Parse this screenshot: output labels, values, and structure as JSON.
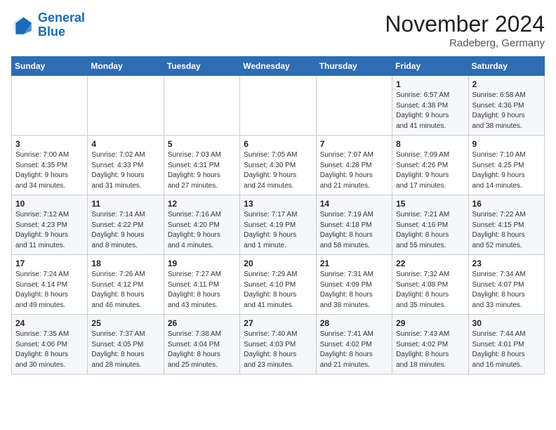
{
  "logo": {
    "text_general": "General",
    "text_blue": "Blue"
  },
  "header": {
    "month": "November 2024",
    "location": "Radeberg, Germany"
  },
  "weekdays": [
    "Sunday",
    "Monday",
    "Tuesday",
    "Wednesday",
    "Thursday",
    "Friday",
    "Saturday"
  ],
  "weeks": [
    [
      {
        "day": "",
        "info": ""
      },
      {
        "day": "",
        "info": ""
      },
      {
        "day": "",
        "info": ""
      },
      {
        "day": "",
        "info": ""
      },
      {
        "day": "",
        "info": ""
      },
      {
        "day": "1",
        "info": "Sunrise: 6:57 AM\nSunset: 4:38 PM\nDaylight: 9 hours\nand 41 minutes."
      },
      {
        "day": "2",
        "info": "Sunrise: 6:58 AM\nSunset: 4:36 PM\nDaylight: 9 hours\nand 38 minutes."
      }
    ],
    [
      {
        "day": "3",
        "info": "Sunrise: 7:00 AM\nSunset: 4:35 PM\nDaylight: 9 hours\nand 34 minutes."
      },
      {
        "day": "4",
        "info": "Sunrise: 7:02 AM\nSunset: 4:33 PM\nDaylight: 9 hours\nand 31 minutes."
      },
      {
        "day": "5",
        "info": "Sunrise: 7:03 AM\nSunset: 4:31 PM\nDaylight: 9 hours\nand 27 minutes."
      },
      {
        "day": "6",
        "info": "Sunrise: 7:05 AM\nSunset: 4:30 PM\nDaylight: 9 hours\nand 24 minutes."
      },
      {
        "day": "7",
        "info": "Sunrise: 7:07 AM\nSunset: 4:28 PM\nDaylight: 9 hours\nand 21 minutes."
      },
      {
        "day": "8",
        "info": "Sunrise: 7:09 AM\nSunset: 4:26 PM\nDaylight: 9 hours\nand 17 minutes."
      },
      {
        "day": "9",
        "info": "Sunrise: 7:10 AM\nSunset: 4:25 PM\nDaylight: 9 hours\nand 14 minutes."
      }
    ],
    [
      {
        "day": "10",
        "info": "Sunrise: 7:12 AM\nSunset: 4:23 PM\nDaylight: 9 hours\nand 11 minutes."
      },
      {
        "day": "11",
        "info": "Sunrise: 7:14 AM\nSunset: 4:22 PM\nDaylight: 9 hours\nand 8 minutes."
      },
      {
        "day": "12",
        "info": "Sunrise: 7:16 AM\nSunset: 4:20 PM\nDaylight: 9 hours\nand 4 minutes."
      },
      {
        "day": "13",
        "info": "Sunrise: 7:17 AM\nSunset: 4:19 PM\nDaylight: 9 hours\nand 1 minute."
      },
      {
        "day": "14",
        "info": "Sunrise: 7:19 AM\nSunset: 4:18 PM\nDaylight: 8 hours\nand 58 minutes."
      },
      {
        "day": "15",
        "info": "Sunrise: 7:21 AM\nSunset: 4:16 PM\nDaylight: 8 hours\nand 55 minutes."
      },
      {
        "day": "16",
        "info": "Sunrise: 7:22 AM\nSunset: 4:15 PM\nDaylight: 8 hours\nand 52 minutes."
      }
    ],
    [
      {
        "day": "17",
        "info": "Sunrise: 7:24 AM\nSunset: 4:14 PM\nDaylight: 8 hours\nand 49 minutes."
      },
      {
        "day": "18",
        "info": "Sunrise: 7:26 AM\nSunset: 4:12 PM\nDaylight: 8 hours\nand 46 minutes."
      },
      {
        "day": "19",
        "info": "Sunrise: 7:27 AM\nSunset: 4:11 PM\nDaylight: 8 hours\nand 43 minutes."
      },
      {
        "day": "20",
        "info": "Sunrise: 7:29 AM\nSunset: 4:10 PM\nDaylight: 8 hours\nand 41 minutes."
      },
      {
        "day": "21",
        "info": "Sunrise: 7:31 AM\nSunset: 4:09 PM\nDaylight: 8 hours\nand 38 minutes."
      },
      {
        "day": "22",
        "info": "Sunrise: 7:32 AM\nSunset: 4:08 PM\nDaylight: 8 hours\nand 35 minutes."
      },
      {
        "day": "23",
        "info": "Sunrise: 7:34 AM\nSunset: 4:07 PM\nDaylight: 8 hours\nand 33 minutes."
      }
    ],
    [
      {
        "day": "24",
        "info": "Sunrise: 7:35 AM\nSunset: 4:06 PM\nDaylight: 8 hours\nand 30 minutes."
      },
      {
        "day": "25",
        "info": "Sunrise: 7:37 AM\nSunset: 4:05 PM\nDaylight: 8 hours\nand 28 minutes."
      },
      {
        "day": "26",
        "info": "Sunrise: 7:38 AM\nSunset: 4:04 PM\nDaylight: 8 hours\nand 25 minutes."
      },
      {
        "day": "27",
        "info": "Sunrise: 7:40 AM\nSunset: 4:03 PM\nDaylight: 8 hours\nand 23 minutes."
      },
      {
        "day": "28",
        "info": "Sunrise: 7:41 AM\nSunset: 4:02 PM\nDaylight: 8 hours\nand 21 minutes."
      },
      {
        "day": "29",
        "info": "Sunrise: 7:43 AM\nSunset: 4:02 PM\nDaylight: 8 hours\nand 18 minutes."
      },
      {
        "day": "30",
        "info": "Sunrise: 7:44 AM\nSunset: 4:01 PM\nDaylight: 8 hours\nand 16 minutes."
      }
    ]
  ]
}
